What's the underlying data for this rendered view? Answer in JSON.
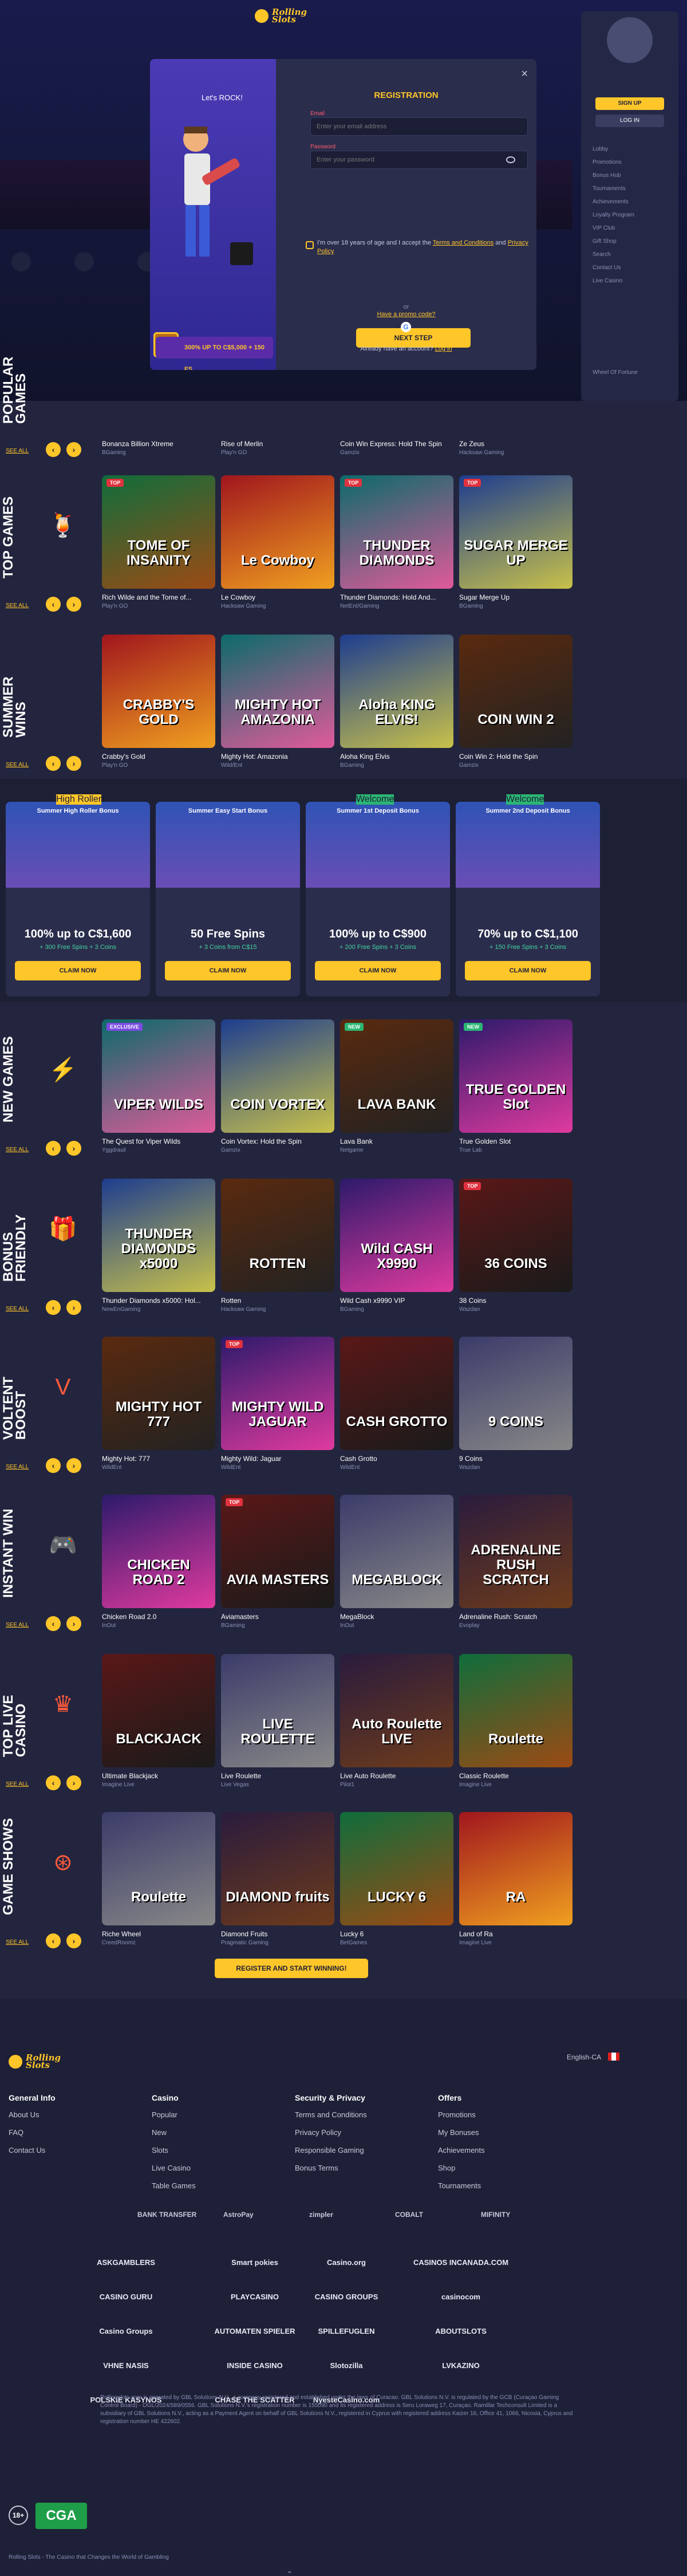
{
  "brand": {
    "line1": "Rolling",
    "line2": "Slots"
  },
  "modal": {
    "greeting": "Let's ROCK!",
    "title": "REGISTRATION",
    "email_label": "Email",
    "email_placeholder": "Enter your email address",
    "password_label": "Password",
    "password_placeholder": "Enter your password",
    "terms_prefix": "I'm over 18 years of age and I accept the ",
    "terms_link": "Terms and Conditions",
    "terms_and": " and ",
    "privacy_link": "Privacy Policy",
    "promo_link": "Have a promo code?",
    "next_button": "NEXT STEP",
    "or": "or",
    "have_account": "Already have an account?",
    "login_link": "Log in",
    "bonus_banner": "300% UP TO C$5,000 + 150 FS",
    "close": "×"
  },
  "side_menu": {
    "signup": "SIGN UP",
    "login": "LOG IN",
    "items": [
      "Lobby",
      "Promotions",
      "Bonus Hub",
      "Tournaments",
      "Achievements",
      "Loyalty Program",
      "VIP Club",
      "Gift Shop",
      "Search",
      "Contact Us",
      "Live Casino",
      "Wheel Of Fortune"
    ]
  },
  "hero": {
    "vertical_title": "POPULAR GAMES"
  },
  "sections": [
    {
      "id": "popular",
      "title": "POPULAR GAMES",
      "see_all": "SEE ALL",
      "games": [
        {
          "name": "Bonanza Billion Xtreme",
          "provider": "BGaming",
          "art": "BONANZA"
        },
        {
          "name": "Rise of Merlin",
          "provider": "Play'n GO",
          "art": "MERLIN"
        },
        {
          "name": "Coin Win Express: Hold The Spin",
          "provider": "Gamzix",
          "art": "COIN WIN"
        },
        {
          "name": "Ze Zeus",
          "provider": "Hacksaw Gaming",
          "art": "ZEUS"
        }
      ]
    },
    {
      "id": "top",
      "title": "TOP GAMES",
      "see_all": "SEE ALL",
      "games": [
        {
          "name": "Rich Wilde and the Tome of...",
          "provider": "Play'n GO",
          "art": "TOME OF INSANITY",
          "badge": "TOP"
        },
        {
          "name": "Le Cowboy",
          "provider": "Hacksaw Gaming",
          "art": "Le Cowboy"
        },
        {
          "name": "Thunder Diamonds: Hold And...",
          "provider": "NetEnt/Gaming",
          "art": "THUNDER DIAMONDS",
          "badge": "TOP"
        },
        {
          "name": "Sugar Merge Up",
          "provider": "BGaming",
          "art": "SUGAR MERGE UP",
          "badge": "TOP"
        }
      ]
    },
    {
      "id": "summer",
      "title": "SUMMER WINS",
      "see_all": "SEE ALL",
      "games": [
        {
          "name": "Crabby's Gold",
          "provider": "Play'n GO",
          "art": "CRABBY'S GOLD"
        },
        {
          "name": "Mighty Hot: Amazonia",
          "provider": "Wild/Ent",
          "art": "MIGHTY HOT AMAZONIA"
        },
        {
          "name": "Aloha King Elvis",
          "provider": "BGaming",
          "art": "Aloha KING ELVIS!"
        },
        {
          "name": "Coin Win 2: Hold the Spin",
          "provider": "Gamzix",
          "art": "COIN WIN 2"
        }
      ]
    },
    {
      "id": "new",
      "title": "NEW GAMES",
      "see_all": "SEE ALL",
      "games": [
        {
          "name": "The Quest for Viper Wilds",
          "provider": "Yggdrasil",
          "art": "VIPER WILDS",
          "badge": "EXCLUSIVE"
        },
        {
          "name": "Coin Vortex: Hold the Spin",
          "provider": "Gamzix",
          "art": "COIN VORTEX"
        },
        {
          "name": "Lava Bank",
          "provider": "Netgame",
          "art": "LAVA BANK",
          "badge": "NEW"
        },
        {
          "name": "True Golden Slot",
          "provider": "True Lab",
          "art": "TRUE GOLDEN Slot",
          "badge": "NEW"
        }
      ]
    },
    {
      "id": "bonus",
      "title": "BONUS FRIENDLY",
      "see_all": "SEE ALL",
      "games": [
        {
          "name": "Thunder Diamonds x5000: Hol...",
          "provider": "NewEnGaming",
          "art": "THUNDER DIAMONDS x5000"
        },
        {
          "name": "Rotten",
          "provider": "Hacksaw Gaming",
          "art": "ROTTEN"
        },
        {
          "name": "Wild Cash x9990 VIP",
          "provider": "BGaming",
          "art": "Wild CASH X9990"
        },
        {
          "name": "38 Coins",
          "provider": "Wazdan",
          "art": "36 COINS",
          "badge": "TOP"
        }
      ]
    },
    {
      "id": "voltent",
      "title": "VOLTENT BOOST",
      "see_all": "SEE ALL",
      "games": [
        {
          "name": "Mighty Hot: 777",
          "provider": "WildEnt",
          "art": "MIGHTY HOT 777"
        },
        {
          "name": "Mighty Wild: Jaguar",
          "provider": "WildEnt",
          "art": "MIGHTY WILD JAGUAR",
          "badge": "TOP"
        },
        {
          "name": "Cash Grotto",
          "provider": "WildEnt",
          "art": "CASH GROTTO"
        },
        {
          "name": "9 Coins",
          "provider": "Wazdan",
          "art": "9 COINS"
        }
      ]
    },
    {
      "id": "instant",
      "title": "INSTANT WIN",
      "see_all": "SEE ALL",
      "games": [
        {
          "name": "Chicken Road 2.0",
          "provider": "InOut",
          "art": "CHICKEN ROAD 2"
        },
        {
          "name": "Aviamasters",
          "provider": "BGaming",
          "art": "AVIA MASTERS",
          "badge": "TOP"
        },
        {
          "name": "MegaBlock",
          "provider": "InOut",
          "art": "MEGABLOCK"
        },
        {
          "name": "Adrenaline Rush: Scratch",
          "provider": "Evoplay",
          "art": "ADRENALINE RUSH SCRATCH"
        }
      ]
    },
    {
      "id": "live",
      "title": "TOP LIVE CASINO",
      "see_all": "SEE ALL",
      "games": [
        {
          "name": "Ultimate Blackjack",
          "provider": "Imagine Live",
          "art": "BLACKJACK"
        },
        {
          "name": "Live Roulette",
          "provider": "Live Vegas",
          "art": "LIVE ROULETTE"
        },
        {
          "name": "Live Auto Roulette",
          "provider": "Pilot1",
          "art": "Auto Roulette LIVE"
        },
        {
          "name": "Classic Roulette",
          "provider": "Imagine Live",
          "art": "Roulette"
        }
      ]
    },
    {
      "id": "shows",
      "title": "GAME SHOWS",
      "see_all": "SEE ALL",
      "games": [
        {
          "name": "Riche Wheel",
          "provider": "CreedRoomz",
          "art": "Roulette"
        },
        {
          "name": "Diamond Fruits",
          "provider": "Pragmatic Gaming",
          "art": "DIAMOND fruits"
        },
        {
          "name": "Lucky 6",
          "provider": "BetGames",
          "art": "LUCKY 6"
        },
        {
          "name": "Land of Ra",
          "provider": "Imagine Live",
          "art": "RA"
        }
      ]
    }
  ],
  "promos": [
    {
      "tag": "High Roller",
      "title": "Summer High Roller Bonus",
      "main": "100% up to C$1,600",
      "sub": "+ 300 Free Spins + 3 Coins",
      "claim": "CLAIM NOW"
    },
    {
      "tag": "",
      "title": "Summer Easy Start Bonus",
      "main": "50 Free Spins",
      "sub": "+ 3 Coins from C$15",
      "claim": "CLAIM NOW"
    },
    {
      "tag": "Welcome",
      "title": "Summer 1st Deposit Bonus",
      "main": "100% up to C$900",
      "sub": "+ 200 Free Spins + 3 Coins",
      "claim": "CLAIM NOW"
    },
    {
      "tag": "Welcome",
      "title": "Summer 2nd Deposit Bonus",
      "main": "70% up to C$1,100",
      "sub": "+ 150 Free Spins + 3 Coins",
      "claim": "CLAIM NOW"
    }
  ],
  "cta": "REGISTER AND START WINNING!",
  "footer": {
    "language": "English-CA",
    "columns": [
      {
        "title": "General Info",
        "links": [
          "About Us",
          "FAQ",
          "Contact Us"
        ]
      },
      {
        "title": "Casino",
        "links": [
          "Popular",
          "New",
          "Slots",
          "Live Casino",
          "Table Games"
        ]
      },
      {
        "title": "Security & Privacy",
        "links": [
          "Terms and Conditions",
          "Privacy Policy",
          "Responsible Gaming",
          "Bonus Terms"
        ]
      },
      {
        "title": "Offers",
        "links": [
          "Promotions",
          "My Bonuses",
          "Achievements",
          "Shop",
          "Tournaments"
        ]
      }
    ],
    "payments": [
      "BANK TRANSFER",
      "AstroPay",
      "zimpler",
      "COBALT",
      "MIFINITY"
    ],
    "reviews": [
      "ASKGAMBLERS",
      "Smart pokies",
      "Casino.org",
      "CASINOS INCANADA.COM",
      "CASINO GURU",
      "PLAYCASINO",
      "CASINO GROUPS",
      "casinocom",
      "Casino Groups",
      "AUTOMATEN SPIELER",
      "SPILLEFUGLEN",
      "ABOUTSLOTS",
      "VHNE NASIS",
      "INSIDE CASINO",
      "Slotozilla",
      "LVKAZINO",
      "POLSKIE KASYNOS",
      "CHASE THE SCATTER",
      "NyesteCasino.com"
    ],
    "legal": "Rollingslots.com is operated by GBL Solutions N.V., a company registered and established under the laws of Curacao. GBL Solutions N.V. is regulated by the GCB (Curaçao Gaming Control Board) - OGL/2024/589/0556. GBL Solutions N.V.'s registration number is 155090 and its registered address is Seru Loraweg 17, Curaçao. Ramillar Techconsult Limited is a subsidiary of GBL Solutions N.V., acting as a Payment Agent on behalf of GBL Solutions N.V., registered in Cyprus with registered address Kaizer 16, Office 41, 1066, Nicosia, Cyprus and registration number HE 422602.",
    "age": "18+",
    "cga": "CGA",
    "slogan": "Rolling Slots - The Casino that Changes the World of Gambling"
  }
}
